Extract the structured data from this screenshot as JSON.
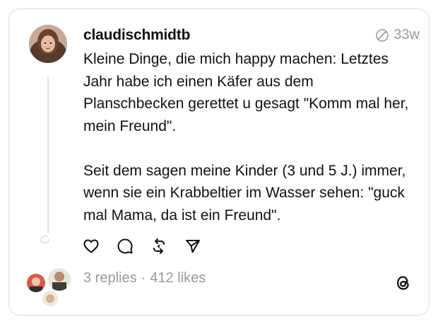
{
  "post": {
    "username": "claudischmidtb",
    "time": "33w",
    "paragraphs": [
      "Kleine Dinge, die mich happy machen: Letztes Jahr habe ich einen Käfer aus dem Planschbecken gerettet u gesagt \"Komm mal her, mein Freund\".",
      "Seit dem sagen meine Kinder (3 und 5 J.) immer, wenn sie ein Krabbeltier im Wasser sehen: \"guck mal Mama, da ist ein Freund\"."
    ]
  },
  "stats": {
    "replies": "3 replies",
    "separator": "·",
    "likes": "412 likes"
  },
  "icons": {
    "verified": "edited-clock-icon",
    "like": "heart-icon",
    "reply": "comment-icon",
    "repost": "repost-icon",
    "share": "send-icon",
    "brand": "threads-logo"
  },
  "colors": {
    "text": "#111111",
    "muted": "#9a9a9a",
    "border": "#dedede"
  }
}
